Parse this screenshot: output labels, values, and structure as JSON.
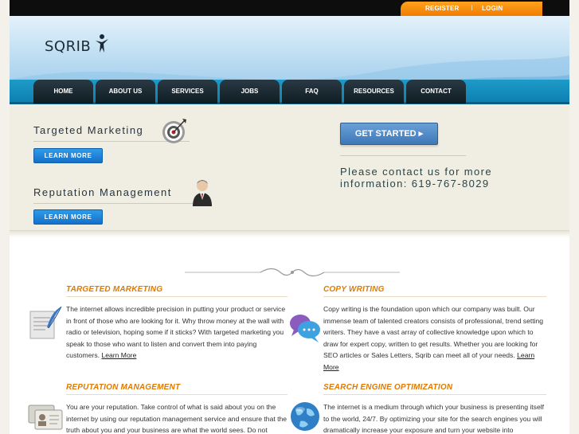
{
  "topbar": {
    "register": "REGISTER",
    "separator": "|",
    "login": "LOGIN"
  },
  "header": {
    "logo_text": "SQRIB",
    "logo_icon": "person-figure-icon"
  },
  "nav": {
    "items": [
      {
        "label": "HOME"
      },
      {
        "label": "ABOUT US"
      },
      {
        "label": "SERVICES"
      },
      {
        "label": "JOBS"
      },
      {
        "label": "FAQ"
      },
      {
        "label": "RESOURCES"
      },
      {
        "label": "CONTACT"
      }
    ]
  },
  "feature": {
    "marketing_title": "Targeted Marketing",
    "marketing_icon": "target-icon",
    "marketing_button": "LEARN MORE",
    "reputation_title": "Reputation Management",
    "reputation_icon": "businessman-icon",
    "reputation_button": "LEARN MORE",
    "get_started": "GET STARTED ▸",
    "contact_line1": "Please contact us for more",
    "contact_line2": "information: 619-767-8029"
  },
  "sections": {
    "targeted": {
      "title": "TARGETED MARKETING",
      "icon": "quill-document-icon",
      "body": "The internet allows incredible precision in putting your product or service in front of those who are looking for it. Why throw money at the wall with radio or television, hoping some if it sticks? With targeted marketing you speak to those who want to listen and convert them into paying customers.",
      "link": "Learn More"
    },
    "copy": {
      "title": "COPY WRITING",
      "icon": "speech-bubbles-icon",
      "body": "Copy writing is the foundation upon which our company was built. Our immense team of talented creators consists of professional, trend setting writers. They have a vast array of collective knowledge upon which to draw for expert copy, written to get results. Whether you are looking for SEO articles or Sales Letters, Sqrib can meet all of your needs.",
      "link": "Learn More"
    },
    "reputation": {
      "title": "REPUTATION MANAGEMENT",
      "icon": "id-cards-icon",
      "body": "You are your reputation. Take control of what is said about you on the internet by using our reputation management service and ensure that the truth about you and your business are what the world sees. Do not"
    },
    "seo": {
      "title": "SEARCH ENGINE OPTIMIZATION",
      "icon": "globe-icon",
      "body": "The internet is a medium through which your business is presenting itself to the world, 24/7. By optimizing your site for the search engines you will dramatically increase your exposure and turn your website into"
    }
  },
  "colors": {
    "accent_orange": "#e07a00",
    "nav_blue": "#1e9bc8",
    "button_blue": "#1f86d8",
    "feature_bg": "#f0eee2"
  }
}
